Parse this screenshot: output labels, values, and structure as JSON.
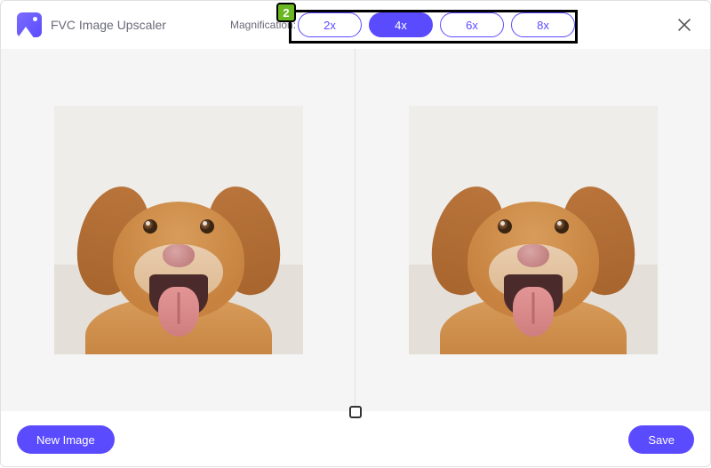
{
  "app": {
    "title": "FVC Image Upscaler"
  },
  "magnification": {
    "label": "Magnification:",
    "options": [
      "2x",
      "4x",
      "6x",
      "8x"
    ],
    "selected": "4x"
  },
  "annotation": {
    "step": "2"
  },
  "footer": {
    "new_image": "New Image",
    "save": "Save"
  },
  "image": {
    "subject": "golden-retriever-dog"
  },
  "colors": {
    "accent": "#5a4bff",
    "panel_bg": "#f5f5f5"
  }
}
